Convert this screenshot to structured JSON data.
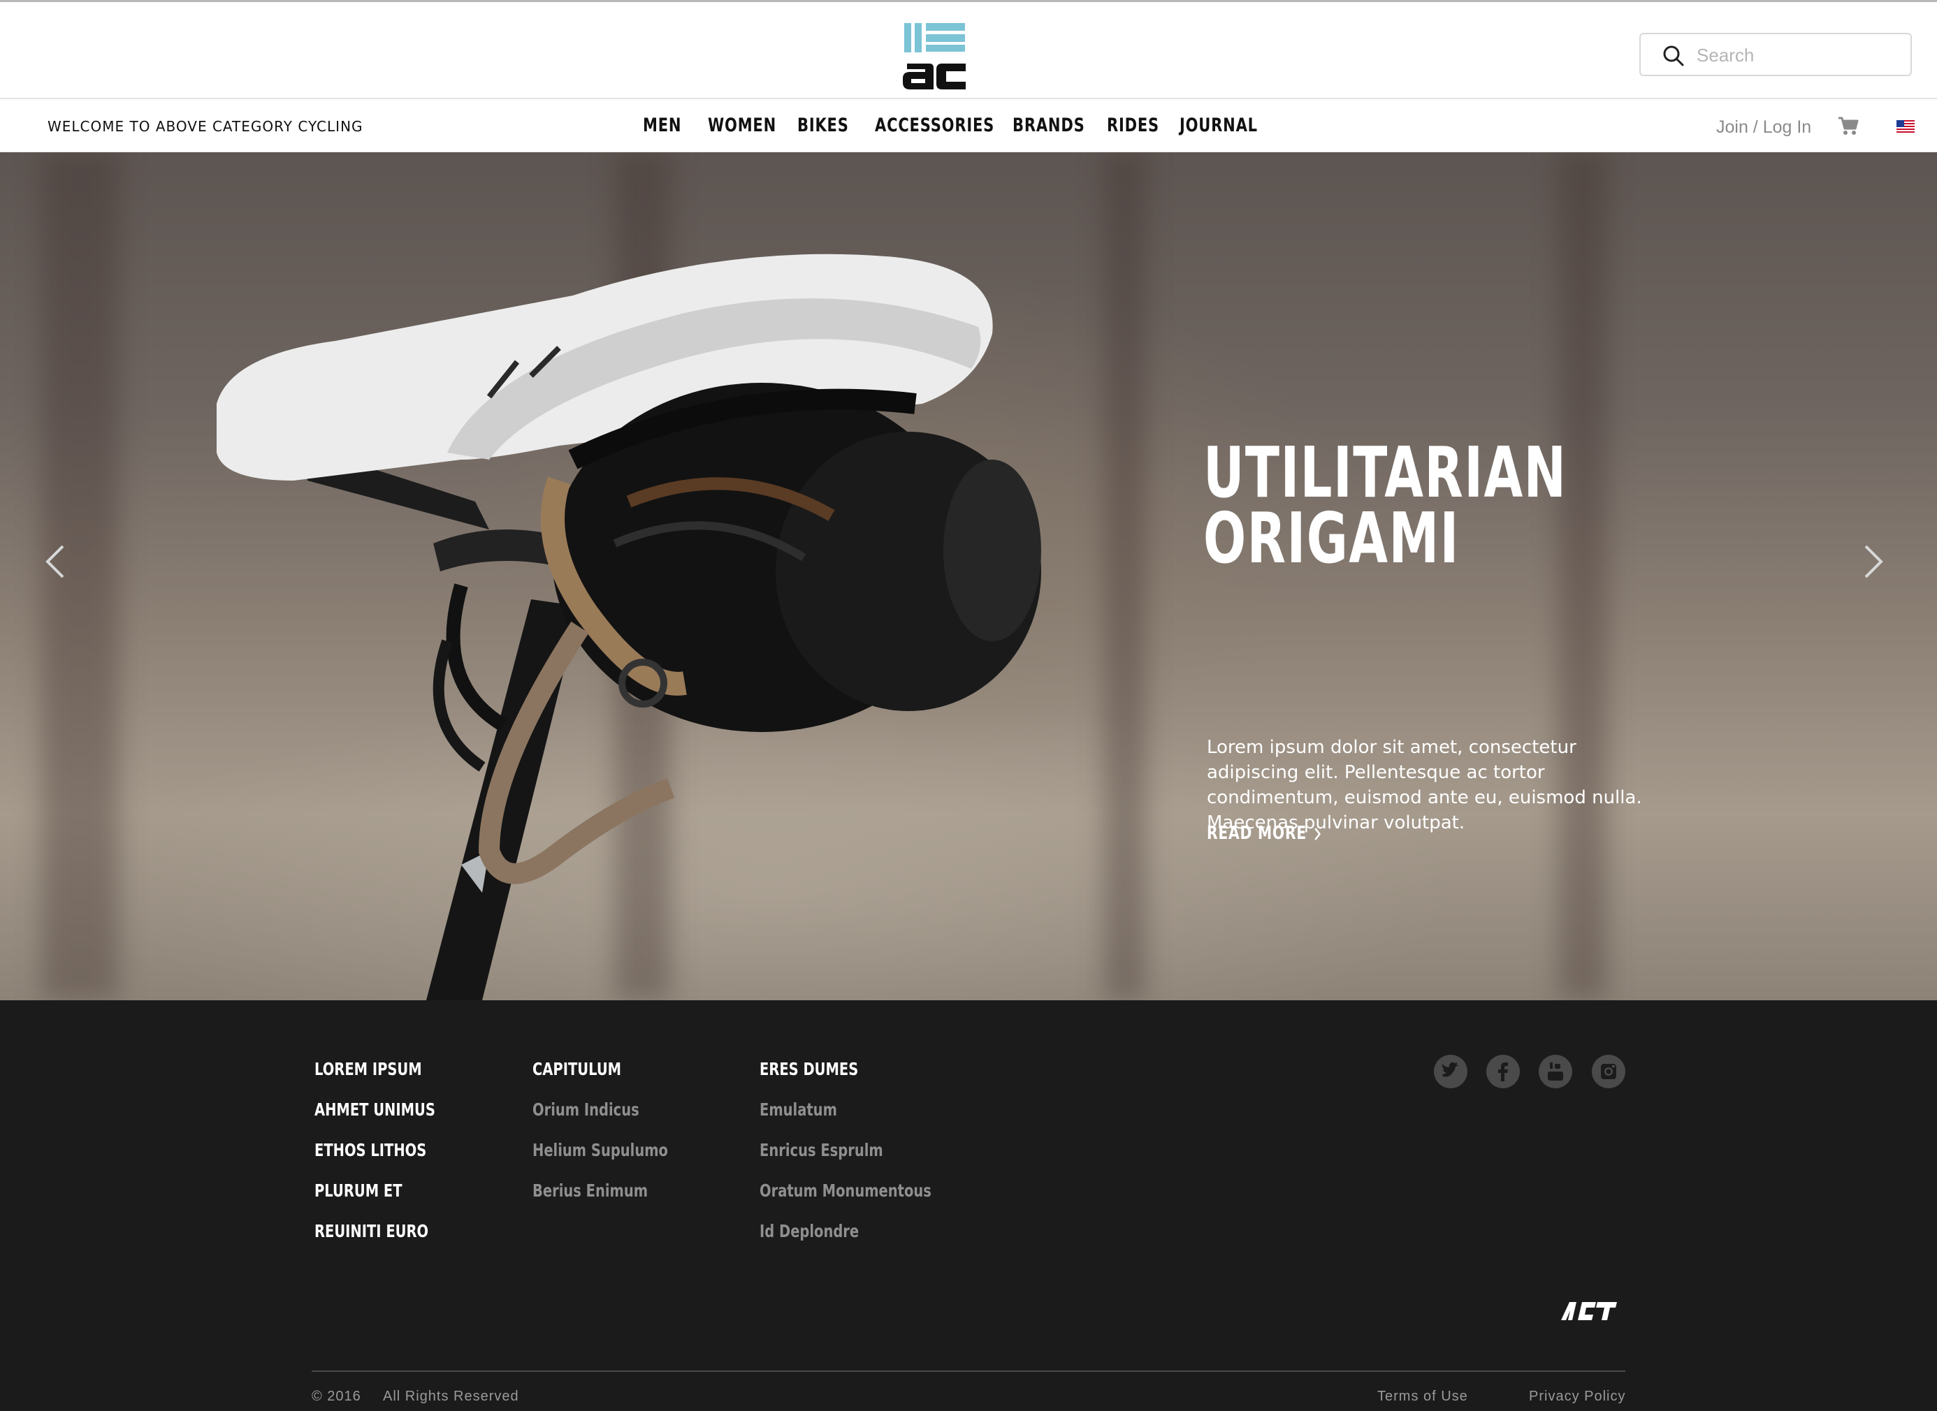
{
  "header": {
    "logo_alt": "ac",
    "search": {
      "placeholder": "Search",
      "value": ""
    }
  },
  "navbar": {
    "welcome": "WELCOME TO ABOVE CATEGORY CYCLING",
    "menu": [
      "MEN",
      "WOMEN",
      "BIKES",
      "ACCESSORIES",
      "BRANDS",
      "RIDES",
      "JOURNAL"
    ],
    "join_label": "Join / Log In"
  },
  "hero": {
    "title_line1": "UTILITARIAN",
    "title_line2": "ORIGAMI",
    "body": "Lorem ipsum dolor sit amet, consectetur adipiscing elit. Pellentesque ac tortor condimentum, euismod ante eu, euismod nulla. Maecenas pulvinar volutpat.",
    "cta": "READ MORE",
    "slide_count": 4,
    "active_slide": 1
  },
  "footer": {
    "col1": [
      "LOREM IPSUM",
      "AHMET UNIMUS",
      "ETHOS LITHOS",
      "PLURUM ET",
      "REUINITI EURO"
    ],
    "col2": {
      "heading": "CAPITULUM",
      "links": [
        "Orium Indicus",
        "Helium Supulumo",
        "Berius Enimum"
      ]
    },
    "col3": {
      "heading": "ERES DUMES",
      "links": [
        "Emulatum",
        "Enricus Esprulm",
        "Oratum Monumentous",
        "Id Deplondre"
      ]
    },
    "social": [
      "twitter-icon",
      "facebook-icon",
      "youtube-icon",
      "instagram-icon"
    ],
    "copyright": "© 2016",
    "rights": "All Rights Reserved",
    "terms": "Terms of Use",
    "privacy": "Privacy Policy"
  },
  "colors": {
    "logo_blue": "#7cc3d6",
    "footer_bg": "#1b1b1b",
    "footer_link": "#8f8f8f"
  }
}
